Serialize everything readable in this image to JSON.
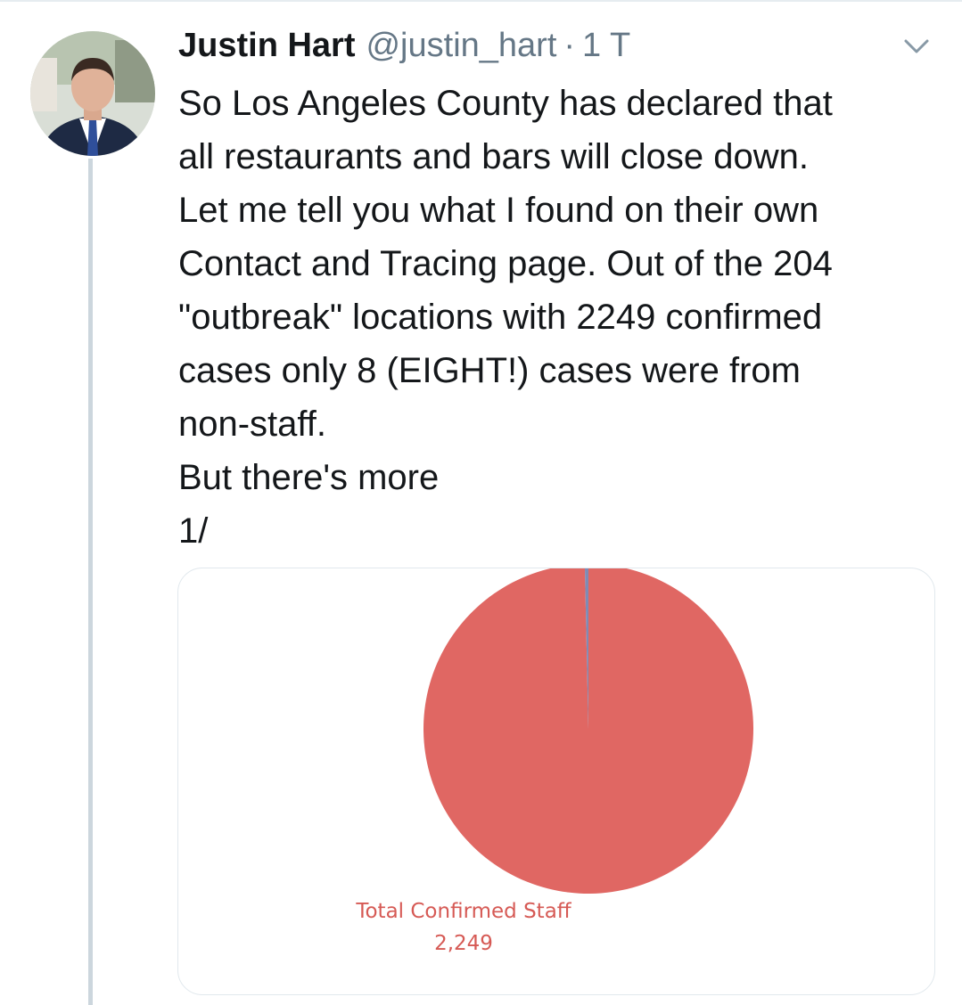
{
  "tweet": {
    "author_name": "Justin Hart",
    "author_handle": "@justin_hart",
    "separator": "·",
    "timestamp": "1 T",
    "text_lines": [
      "So Los Angeles County has declared that",
      "all restaurants and bars will close down.",
      "Let me tell you what I found on their own",
      "Contact and Tracing page. Out of the 204",
      "\"outbreak\" locations with 2249 confirmed",
      "cases only 8 (EIGHT!) cases were from",
      "non-staff.",
      "But there's more",
      "1/"
    ]
  },
  "icons": {
    "avatar": "profile-photo",
    "caret": "chevron-down-icon"
  },
  "colors": {
    "pie_staff": "#e06763",
    "pie_nonstaff": "#7f8bb5",
    "label": "#d65a55",
    "muted": "#657786",
    "thread_line": "#ccd6dd"
  },
  "chart_data": {
    "type": "pie",
    "slices": [
      {
        "label": "Total Confirmed Staff",
        "value": 2249,
        "display_value": "2,249"
      },
      {
        "label": "",
        "value": 8
      }
    ]
  }
}
